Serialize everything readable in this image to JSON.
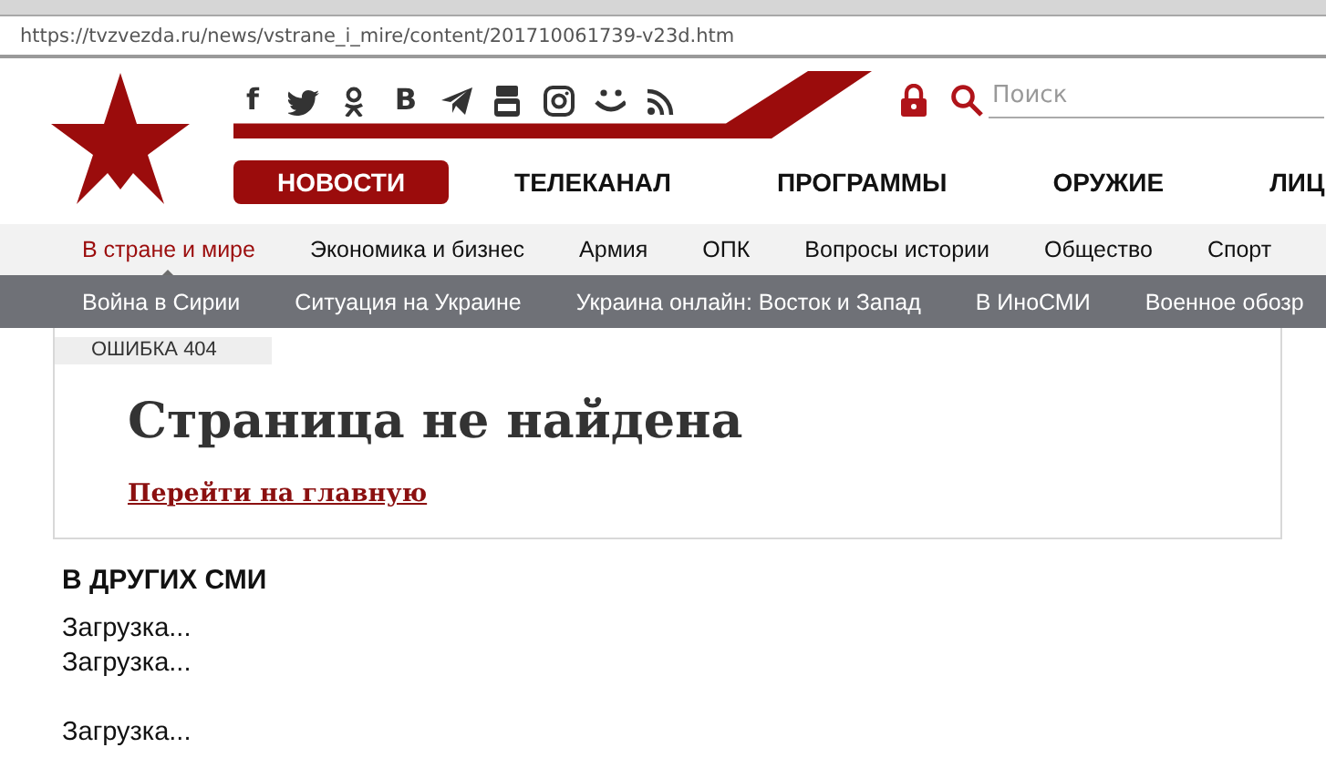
{
  "browser": {
    "url": "https://tvzvezda.ru/news/vstrane_i_mire/content/201710061739-v23d.htm"
  },
  "header": {
    "social": [
      {
        "kind": "letter",
        "glyph": "f"
      },
      {
        "kind": "bird"
      },
      {
        "kind": "ok"
      },
      {
        "kind": "letter",
        "glyph": "B"
      },
      {
        "kind": "plane"
      },
      {
        "kind": "tube"
      },
      {
        "kind": "camera"
      },
      {
        "kind": "smile"
      },
      {
        "kind": "rss"
      }
    ],
    "search": {
      "placeholder": "Поиск"
    }
  },
  "main_nav": [
    {
      "label": "НОВОСТИ",
      "selected": true
    },
    {
      "label": "ТЕЛЕКАНАЛ",
      "selected": false
    },
    {
      "label": "ПРОГРАММЫ",
      "selected": false
    },
    {
      "label": "ОРУЖИЕ",
      "selected": false
    },
    {
      "label": "ЛИЦ",
      "selected": false
    }
  ],
  "sub_nav": [
    {
      "label": "В стране и мире",
      "selected": true
    },
    {
      "label": "Экономика и бизнес",
      "selected": false
    },
    {
      "label": "Армия",
      "selected": false
    },
    {
      "label": "ОПК",
      "selected": false
    },
    {
      "label": "Вопросы истории",
      "selected": false
    },
    {
      "label": "Общество",
      "selected": false
    },
    {
      "label": "Спорт",
      "selected": false
    }
  ],
  "topics": [
    "Война в Сирии",
    "Ситуация на Украине",
    "Украина онлайн: Восток и Запад",
    "В ИноСМИ",
    "Военное обозр"
  ],
  "error": {
    "badge": "ОШИБКА 404",
    "title": "Страница не найдена",
    "link": "Перейти на главную"
  },
  "other_media": {
    "title": "В ДРУГИХ СМИ",
    "items": [
      {
        "text": "Загрузка...",
        "spaced": false
      },
      {
        "text": "Загрузка...",
        "spaced": false
      },
      {
        "text": "Загрузка...",
        "spaced": true
      }
    ]
  }
}
